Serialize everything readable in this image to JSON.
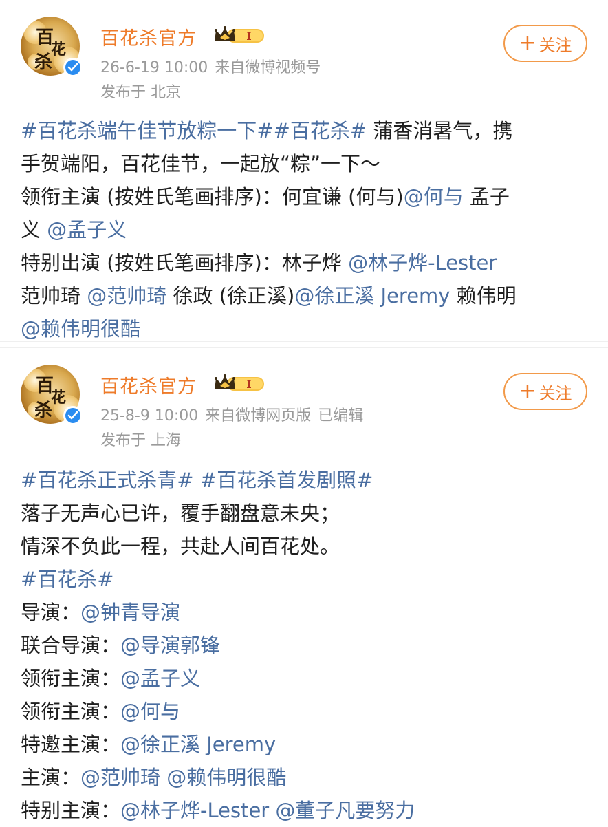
{
  "posts": [
    {
      "account_name": "百花杀官方",
      "vip_level": "I",
      "time": "26-6-19 10:00",
      "source": "来自微博视频号",
      "edited": "",
      "location": "发布于 北京",
      "follow_label": "关注",
      "lines": [
        [
          {
            "t": "#百花杀端午佳节放粽一下##百花杀#",
            "c": "blue"
          },
          {
            "t": " 蒲香消暑气，携",
            "c": "plain"
          }
        ],
        [
          {
            "t": "手贺端阳，百花佳节，一起放“粽”一下～",
            "c": "plain"
          }
        ],
        [
          {
            "t": "领衔主演 (按姓氏笔画排序)：何宜谦 (何与)",
            "c": "plain"
          },
          {
            "t": "@何与",
            "c": "blue"
          },
          {
            "t": " 孟子",
            "c": "plain"
          }
        ],
        [
          {
            "t": "义 ",
            "c": "plain"
          },
          {
            "t": "@孟子义",
            "c": "blue"
          }
        ],
        [
          {
            "t": "特别出演 (按姓氏笔画排序)：林子烨 ",
            "c": "plain"
          },
          {
            "t": "@林子烨-Lester",
            "c": "blue"
          }
        ],
        [
          {
            "t": "范帅琦 ",
            "c": "plain"
          },
          {
            "t": "@范帅琦",
            "c": "blue"
          },
          {
            "t": " 徐政 (徐正溪)",
            "c": "plain"
          },
          {
            "t": "@徐正溪 Jeremy",
            "c": "blue"
          },
          {
            "t": "  赖伟明",
            "c": "plain"
          }
        ],
        [
          {
            "t": "@赖伟明很酷",
            "c": "blue"
          }
        ]
      ]
    },
    {
      "account_name": "百花杀官方",
      "vip_level": "I",
      "time": "25-8-9 10:00",
      "source": "来自微博网页版",
      "edited": "已编辑",
      "location": "发布于 上海",
      "follow_label": "关注",
      "lines": [
        [
          {
            "t": "#百花杀正式杀青# #百花杀首发剧照#",
            "c": "blue"
          }
        ],
        [
          {
            "t": "落子无声心已许，覆手翻盘意未央；",
            "c": "plain"
          }
        ],
        [
          {
            "t": "情深不负此一程，共赴人间百花处。",
            "c": "plain"
          }
        ],
        [
          {
            "t": "#百花杀#",
            "c": "blue"
          }
        ],
        [
          {
            "t": "导演：",
            "c": "plain"
          },
          {
            "t": "@钟青导演",
            "c": "blue"
          }
        ],
        [
          {
            "t": "联合导演：",
            "c": "plain"
          },
          {
            "t": "@导演郭锋",
            "c": "blue"
          }
        ],
        [
          {
            "t": "领衔主演：",
            "c": "plain"
          },
          {
            "t": "@孟子义",
            "c": "blue"
          }
        ],
        [
          {
            "t": "领衔主演：",
            "c": "plain"
          },
          {
            "t": "@何与",
            "c": "blue"
          }
        ],
        [
          {
            "t": "特邀主演：",
            "c": "plain"
          },
          {
            "t": "@徐正溪 Jeremy",
            "c": "blue"
          }
        ],
        [
          {
            "t": "主演：",
            "c": "plain"
          },
          {
            "t": "@范帅琦 @赖伟明很酷",
            "c": "blue"
          }
        ],
        [
          {
            "t": "特别主演：",
            "c": "plain"
          },
          {
            "t": "@林子烨-Lester @董子凡要努力",
            "c": "blue"
          }
        ]
      ]
    }
  ],
  "colors": {
    "link": "#4a6ea1",
    "name": "#ee7b2a",
    "follow_border": "#f29a4a",
    "meta": "#9a9a9a"
  },
  "icons": {
    "verified": "verified-badge-icon",
    "vip": "vip-crown-badge-icon",
    "follow": "plus-icon"
  }
}
